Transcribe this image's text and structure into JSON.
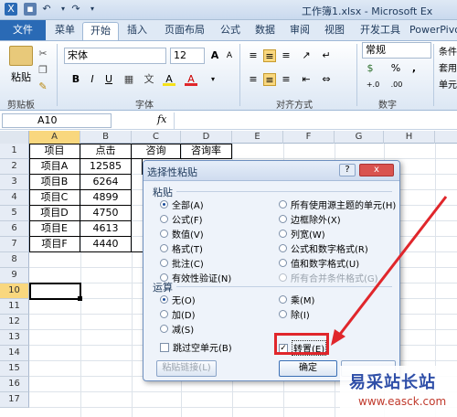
{
  "window": {
    "title": "工作簿1.xlsx - Microsoft Ex"
  },
  "qat": {
    "undo": "↶",
    "redo": "↷"
  },
  "tabs": [
    "文件",
    "菜单",
    "开始",
    "插入",
    "页面布局",
    "公式",
    "数据",
    "审阅",
    "视图",
    "开发工具",
    "PowerPivo"
  ],
  "ribbon": {
    "paste_label": "粘贴",
    "clipboard_label": "剪贴板",
    "font_name": "宋体",
    "font_size": "12",
    "font_label": "字体",
    "align_label": "对齐方式",
    "number_format": "常规",
    "number_label": "数字",
    "style_items": [
      "条件",
      "套用",
      "单元"
    ],
    "bold": "B",
    "italic": "I",
    "underline": "U",
    "wen": "文",
    "font_color": "A",
    "fill_color": "A",
    "currency": "$",
    "percent": "%",
    "comma": ",",
    "grow": "A",
    "shrink": "A",
    "dec_more": "+.0",
    "dec_less": ".00"
  },
  "formula": {
    "cell_ref": "A10",
    "fx": "fx"
  },
  "columns": [
    "A",
    "B",
    "C",
    "D",
    "E",
    "F",
    "G",
    "H"
  ],
  "rows": [
    "1",
    "2",
    "3",
    "4",
    "5",
    "6",
    "7",
    "8",
    "9",
    "10",
    "11",
    "12",
    "13",
    "14",
    "15",
    "16",
    "17"
  ],
  "table": {
    "header": [
      "项目",
      "点击",
      "咨询",
      "咨询率"
    ],
    "items": [
      [
        "项目A",
        "12585"
      ],
      [
        "项目B",
        "6264"
      ],
      [
        "项目C",
        "4899"
      ],
      [
        "项目D",
        "4750"
      ],
      [
        "项目E",
        "4613"
      ],
      [
        "项目F",
        "4440"
      ]
    ]
  },
  "dialog": {
    "title": "选择性粘贴",
    "help": "?",
    "close": "x",
    "paste_section": "粘贴",
    "paste_left": [
      {
        "label": "全部(A)",
        "checked": true
      },
      {
        "label": "公式(F)",
        "checked": false
      },
      {
        "label": "数值(V)",
        "checked": false
      },
      {
        "label": "格式(T)",
        "checked": false
      },
      {
        "label": "批注(C)",
        "checked": false
      },
      {
        "label": "有效性验证(N)",
        "checked": false
      }
    ],
    "paste_right": [
      {
        "label": "所有使用源主题的单元(H)",
        "checked": false
      },
      {
        "label": "边框除外(X)",
        "checked": false
      },
      {
        "label": "列宽(W)",
        "checked": false
      },
      {
        "label": "公式和数字格式(R)",
        "checked": false
      },
      {
        "label": "值和数字格式(U)",
        "checked": false
      },
      {
        "label": "所有合并条件格式(G)",
        "checked": false
      }
    ],
    "op_section": "运算",
    "op_left": [
      {
        "label": "无(O)",
        "checked": true
      },
      {
        "label": "加(D)",
        "checked": false
      },
      {
        "label": "减(S)",
        "checked": false
      }
    ],
    "op_right": [
      {
        "label": "乘(M)",
        "checked": false
      },
      {
        "label": "除(I)",
        "checked": false
      }
    ],
    "skip_blanks": "跳过空单元(B)",
    "transpose": "转置(E)",
    "paste_link": "粘贴链接(L)",
    "ok": "确定"
  },
  "watermark": {
    "line1": "易采站长站",
    "line2": "www.easck.com"
  },
  "colors": {
    "annotation": "#e0262b",
    "file_tab": "#2a6ab5"
  }
}
